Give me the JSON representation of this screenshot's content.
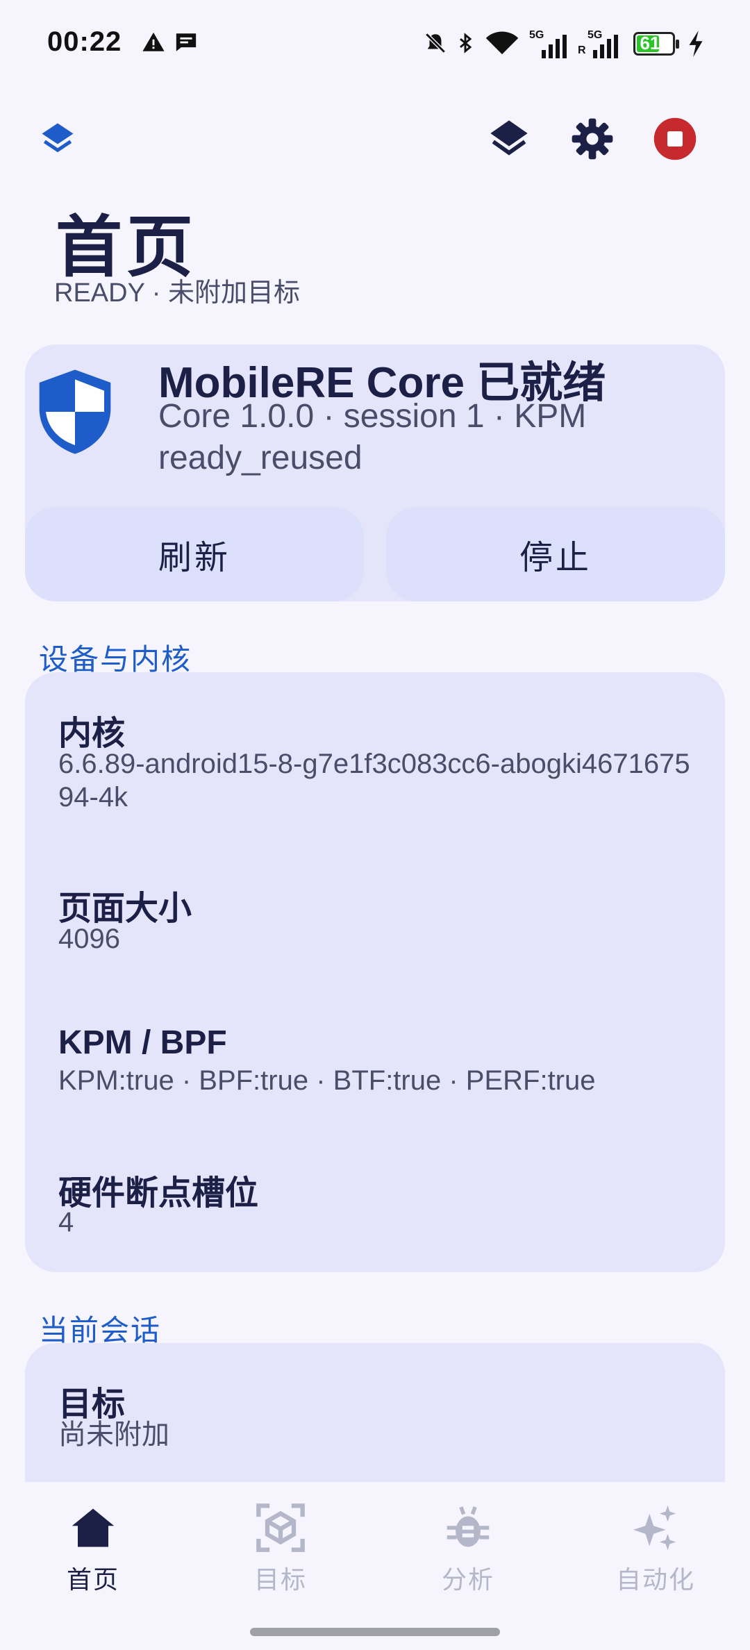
{
  "status_bar": {
    "time": "00:22",
    "battery": "61",
    "icons": [
      "warning-icon",
      "message-icon",
      "mute-icon",
      "bluetooth-icon",
      "wifi-icon",
      "signal-5g-icon",
      "signal-5g-r-icon",
      "battery-icon",
      "charging-icon"
    ]
  },
  "toolbar": {
    "icons": [
      "layers-icon",
      "layers-icon",
      "gear-icon",
      "stop-icon"
    ],
    "colors": {
      "accent": "#1e5dc9",
      "stop": "#c62a2f"
    }
  },
  "header": {
    "title": "首页",
    "subtitle": "READY · 未附加目标"
  },
  "core_card": {
    "title": "MobileRE Core 已就绪",
    "subtitle": "Core 1.0.0 · session 1 · KPM ready_reused",
    "refresh_label": "刷新",
    "stop_label": "停止"
  },
  "device_section": {
    "label": "设备与内核",
    "items": [
      {
        "title": "内核",
        "value": "6.6.89-android15-8-g7e1f3c083cc6-abogki467167594-4k"
      },
      {
        "title": "页面大小",
        "value": "4096"
      },
      {
        "title": "KPM / BPF",
        "value": "KPM:true · BPF:true · BTF:true · PERF:true"
      },
      {
        "title": "硬件断点槽位",
        "value": "4"
      }
    ]
  },
  "session_section": {
    "label": "当前会话",
    "items": [
      {
        "title": "目标",
        "value": "尚未附加"
      }
    ]
  },
  "bottom_nav": {
    "items": [
      {
        "label": "首页",
        "icon": "home-icon",
        "active": true
      },
      {
        "label": "目标",
        "icon": "target-icon",
        "active": false
      },
      {
        "label": "分析",
        "icon": "bug-icon",
        "active": false
      },
      {
        "label": "自动化",
        "icon": "sparkle-icon",
        "active": false
      }
    ]
  }
}
